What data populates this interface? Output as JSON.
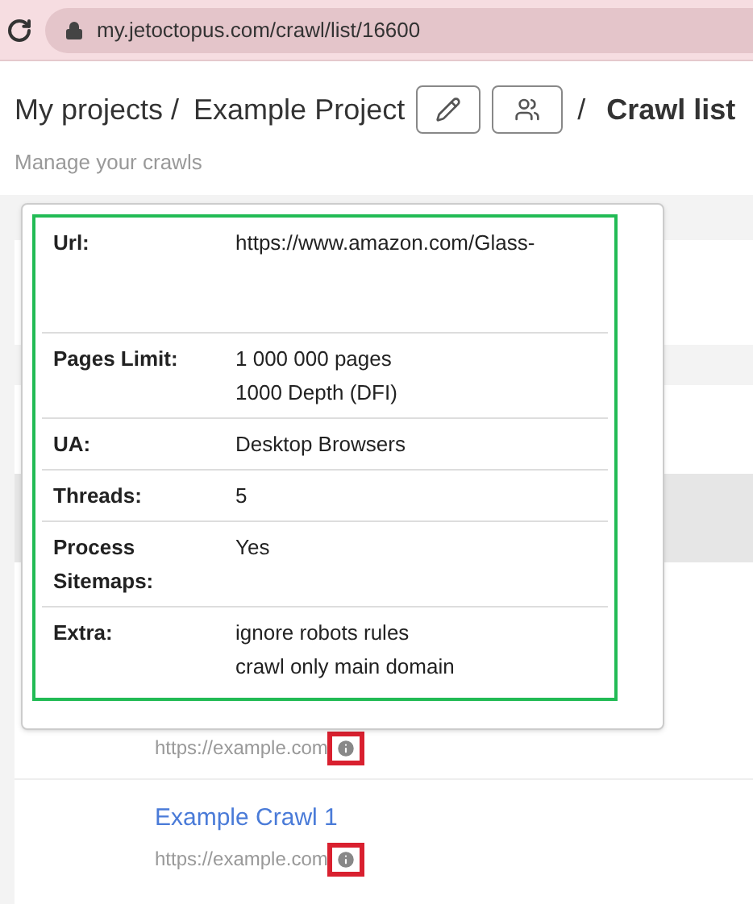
{
  "browser": {
    "url": "my.jetoctopus.com/crawl/list/16600"
  },
  "header": {
    "breadcrumb": [
      "My projects /",
      "Example Project"
    ],
    "separator": "/",
    "title": "Crawl list",
    "subtitle": "Manage your crawls"
  },
  "popover": {
    "rows": [
      {
        "label": "Url:",
        "lines": [
          "https://www.amazon.com/Glass-"
        ]
      },
      {
        "label": "Pages Limit:",
        "lines": [
          "1 000 000 pages",
          "1000 Depth (DFI)"
        ]
      },
      {
        "label": "UA:",
        "lines": [
          "Desktop Browsers"
        ]
      },
      {
        "label": "Threads:",
        "lines": [
          "5"
        ]
      },
      {
        "label": "Process Sitemaps:",
        "lines": [
          "Yes"
        ]
      },
      {
        "label": "Extra:",
        "lines": [
          "ignore robots rules",
          "crawl only main domain"
        ]
      }
    ]
  },
  "crawls": [
    {
      "url": "https://example.com"
    },
    {
      "name": "Example Crawl 1",
      "url": "https://example.com"
    }
  ]
}
